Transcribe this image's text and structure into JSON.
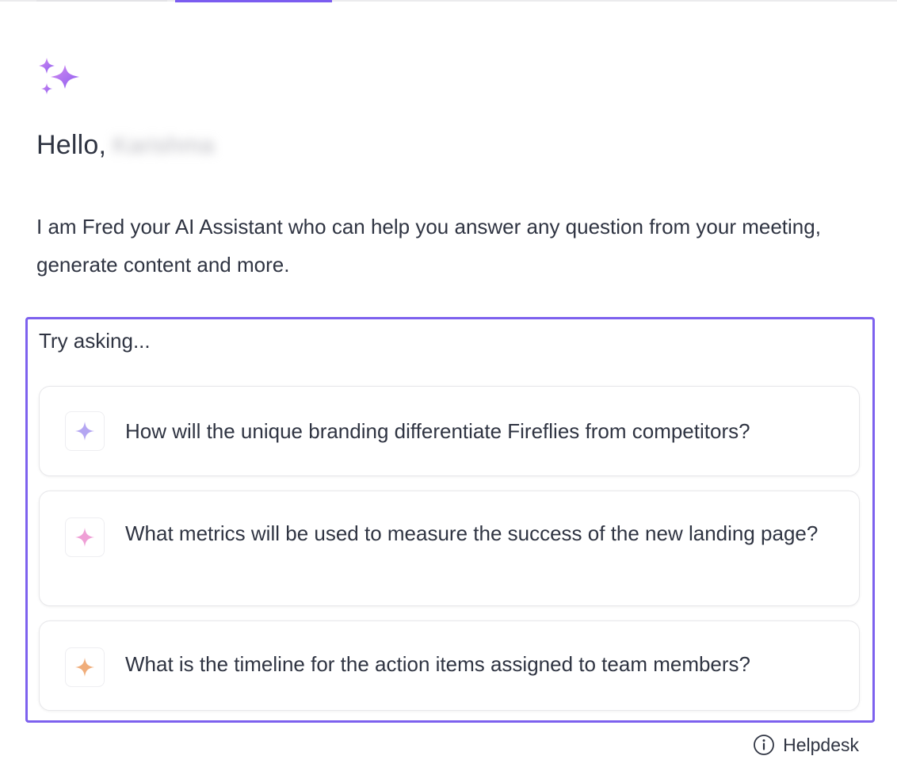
{
  "greeting": {
    "prefix": "Hello,",
    "name": "Karishma"
  },
  "intro": "I am Fred your AI Assistant who can help you answer any question from your meeting, generate content and more.",
  "suggestions": {
    "label": "Try asking...",
    "items": [
      {
        "text": "How will the unique branding differentiate Fireflies from competitors?",
        "icon": "sparkle-icon",
        "color": "#b4a6f2"
      },
      {
        "text": "What metrics will be used to measure the success of the new landing page?",
        "icon": "sparkle-icon",
        "color": "#ef9fd6"
      },
      {
        "text": "What is the timeline for the action items assigned to team members?",
        "icon": "sparkle-icon",
        "color": "#f0ad7a"
      }
    ]
  },
  "footer": {
    "helpdesk_label": "Helpdesk",
    "helpdesk_icon": "info-icon"
  },
  "colors": {
    "accent": "#7b5cf0",
    "text": "#2f3442"
  }
}
